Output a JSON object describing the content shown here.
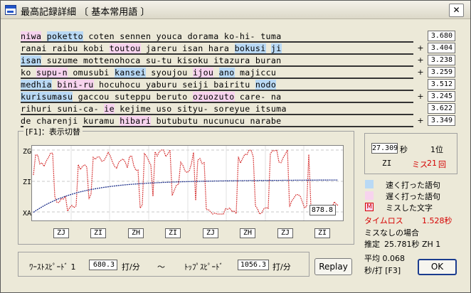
{
  "window": {
    "title": "最高記録詳細 〔 基本常用語 〕",
    "close_glyph": "✕"
  },
  "typing_lines": [
    {
      "mark": "",
      "score": "3.680",
      "segments": [
        {
          "t": "niwa",
          "k": "slow"
        },
        {
          "t": " ",
          "k": "normal"
        },
        {
          "t": "poketto",
          "k": "fast"
        },
        {
          "t": " coten sennen youca dorama ko-hi- tuma",
          "k": "normal"
        }
      ]
    },
    {
      "mark": "+",
      "score": "3.404",
      "segments": [
        {
          "t": "ranai raibu kobi ",
          "k": "normal"
        },
        {
          "t": "toutou",
          "k": "slow"
        },
        {
          "t": " jareru isan hara ",
          "k": "normal"
        },
        {
          "t": "bokusi",
          "k": "fast"
        },
        {
          "t": " ",
          "k": "normal"
        },
        {
          "t": "ji",
          "k": "fast"
        }
      ]
    },
    {
      "mark": "+",
      "score": "3.238",
      "segments": [
        {
          "t": "isan",
          "k": "fast"
        },
        {
          "t": " suzume mottenohoca su-tu kisoku itazura buran",
          "k": "normal"
        }
      ]
    },
    {
      "mark": "+",
      "score": "3.259",
      "segments": [
        {
          "t": "ko ",
          "k": "normal"
        },
        {
          "t": "supu-n",
          "k": "slow"
        },
        {
          "t": " omusubi ",
          "k": "normal"
        },
        {
          "t": "kansei",
          "k": "fast"
        },
        {
          "t": " syoujou ",
          "k": "normal"
        },
        {
          "t": "ijou",
          "k": "slow"
        },
        {
          "t": " ",
          "k": "normal"
        },
        {
          "t": "ano",
          "k": "fast"
        },
        {
          "t": " majiccu",
          "k": "normal"
        }
      ]
    },
    {
      "mark": "",
      "score": "3.512",
      "segments": [
        {
          "t": "medhia",
          "k": "fast"
        },
        {
          "t": " ",
          "k": "normal"
        },
        {
          "t": "bini-ru",
          "k": "slow"
        },
        {
          "t": " hocuhocu yaburu seiji bairitu ",
          "k": "normal"
        },
        {
          "t": "nodo",
          "k": "fast"
        }
      ]
    },
    {
      "mark": "+",
      "score": "3.245",
      "segments": [
        {
          "t": "kurisumasu",
          "k": "fast"
        },
        {
          "t": " gaccou suteppu beruto ",
          "k": "normal"
        },
        {
          "t": "ozuozuto",
          "k": "slow"
        },
        {
          "t": " care- na",
          "k": "normal"
        }
      ]
    },
    {
      "mark": "",
      "score": "3.622",
      "segments": [
        {
          "t": "rihuri suni-ca- ",
          "k": "normal"
        },
        {
          "t": "ie",
          "k": "slow"
        },
        {
          "t": " kejime uso sityu- soreyue itsuma",
          "k": "normal"
        }
      ]
    },
    {
      "mark": "+",
      "score": "3.349",
      "segments": [
        {
          "t": "de charenji kuramu ",
          "k": "normal"
        },
        {
          "t": "hibari",
          "k": "slow"
        },
        {
          "t": " butubutu nucunucu narabe",
          "k": "normal"
        }
      ]
    }
  ],
  "graph": {
    "group_label": "[F1]：表示切替",
    "grade_labels": [
      "ZG",
      "ZI",
      "XA"
    ],
    "time_readout": "878.8",
    "segment_grades": [
      "ZJ",
      "ZI",
      "ZH",
      "ZI",
      "ZJ",
      "ZH",
      "ZJ",
      "ZI"
    ],
    "colors": {
      "speed": "#d01818",
      "average": "#1d2f8a",
      "grid": "#c8c8c8"
    }
  },
  "summary": {
    "total_time": "27.309",
    "seconds_unit": "秒",
    "rank": "1位",
    "grade": "ZI",
    "miss_label": "ミス",
    "miss_count": "21",
    "miss_unit": "回"
  },
  "legend": [
    {
      "color": "#b9d9f5",
      "text": "速く打った語句"
    },
    {
      "color": "#f7d3ee",
      "text": "遅く打った語句"
    },
    {
      "color": "#d50000",
      "text": "ミスした文字",
      "swatch_glyph": "M"
    }
  ],
  "time_loss": {
    "label": "タイムロス",
    "value": "1.528秒"
  },
  "no_miss": {
    "label": "ミスなしの場合",
    "estimate_label": "推定",
    "estimate_value": "25.781秒 ZH 1"
  },
  "speed": {
    "worst_label": "ﾜｰｽﾄｽﾋﾟｰﾄﾞ 1",
    "worst_value": "680.3",
    "worst_unit": "打/分",
    "tilde": "〜",
    "top_label": "ﾄｯﾌﾟｽﾋﾟｰﾄﾞ",
    "top_value": "1056.3",
    "top_unit": "打/分"
  },
  "average": {
    "line1": "平均 0.068",
    "line2": "秒/打 [F3]"
  },
  "buttons": {
    "replay": "Replay",
    "ok": "OK"
  }
}
